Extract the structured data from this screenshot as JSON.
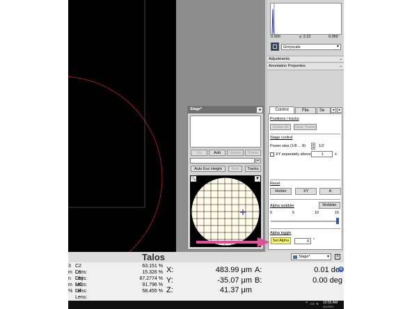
{
  "histogram": {
    "min_value": "0.000",
    "gamma": "γ: 2.22",
    "max_value": "0.050",
    "lut": "Greyscale"
  },
  "side_panels": {
    "adjustments": "Adjustments",
    "annotation": "Annotation Properties"
  },
  "stage_window": {
    "title": "Stage*",
    "go": "Go",
    "add": "Add",
    "update": "Update",
    "delete": "Delete",
    "auto_euc": "Auto Euc Height",
    "find": "Find",
    "tracks": "Tracks"
  },
  "control_panel": {
    "tabs": [
      "Control",
      "File",
      "Se"
    ],
    "positions_header": "Positions / tracks",
    "delete_all": "Delete All",
    "clear_tracks": "Clear Tracks",
    "stage_control_header": "Stage control",
    "power_step_label": "Power step (1/8 ... 8)",
    "power_step_value": "1/2",
    "xy_separately": "XY separately above",
    "xy_value": "1",
    "xy_unit": "x",
    "reset_header": "Reset",
    "holder": "Holder",
    "xy": "XY",
    "a": "A",
    "alpha_wobbler_header": "Alpha wobbler",
    "wobbler_btn": "Wobbler",
    "scale": [
      "0",
      "5",
      "10",
      "15"
    ],
    "alpha_toggle_header": "Alpha toggle",
    "set_alpha": "Set Alpha",
    "alpha_value": "0",
    "alpha_unit": "°"
  },
  "status_bar": {
    "title": "Talos",
    "dropdown": "Stage*",
    "lens_prefix": [
      "3",
      "m",
      "n",
      "m",
      "%"
    ],
    "lenses": [
      {
        "label": "C2 Lens:",
        "value": "63.151 %"
      },
      {
        "label": "C1 Lens:",
        "value": "15.326 %"
      },
      {
        "label": "Obj Lens:",
        "value": "87.2774 %"
      },
      {
        "label": "MC Lens:",
        "value": "91.796 %"
      },
      {
        "label": "Dif Lens:",
        "value": "58.455 %"
      }
    ],
    "x_label": "X:",
    "x_value": "483.99 μm",
    "y_label": "Y:",
    "y_value": "-35.07 μm",
    "z_label": "Z:",
    "z_value": "41.37 μm",
    "a_label": "A:",
    "a_value": "0.01 de",
    "b_label": "B:",
    "b_value": "0.00 deg"
  },
  "taskbar": {
    "time": "10:55 AM",
    "date": "4/1/2021"
  },
  "colors": {
    "annotation_arrow": "#e0509c",
    "stage_marker": "#3333cc",
    "highlight_button": "#ffff66"
  }
}
